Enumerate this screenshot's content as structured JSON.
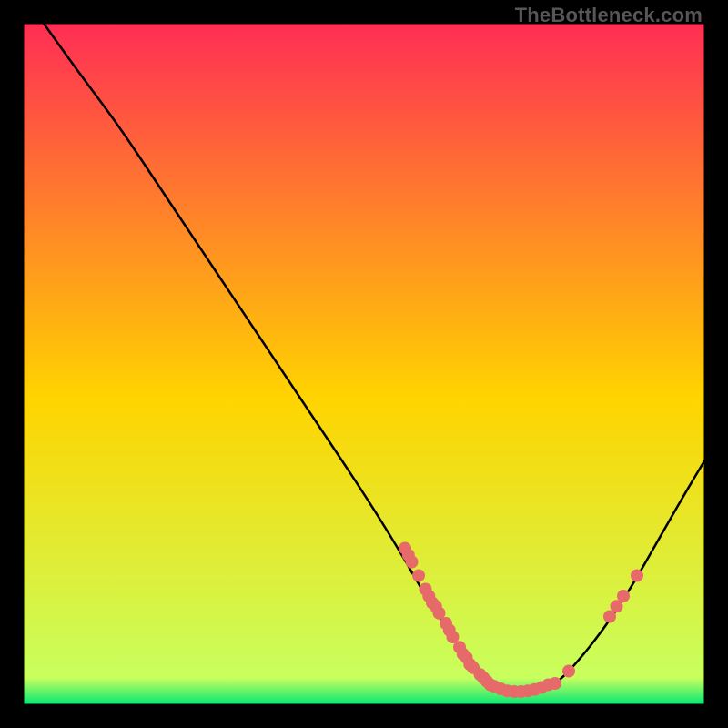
{
  "watermark": "TheBottleneck.com",
  "colors": {
    "gradient_top": "#ff2d55",
    "gradient_mid": "#ffd400",
    "gradient_bottom": "#00e676",
    "curve": "#000000",
    "dot": "#e66a6a",
    "frame": "#000000"
  },
  "chart_data": {
    "type": "line",
    "title": "",
    "xlabel": "",
    "ylabel": "",
    "xlim": [
      0,
      100
    ],
    "ylim": [
      0,
      100
    ],
    "grid": false,
    "legend": false,
    "curve": [
      {
        "x": 3,
        "y": 100
      },
      {
        "x": 8,
        "y": 93
      },
      {
        "x": 14,
        "y": 85
      },
      {
        "x": 20,
        "y": 76
      },
      {
        "x": 26,
        "y": 67
      },
      {
        "x": 32,
        "y": 58
      },
      {
        "x": 38,
        "y": 49
      },
      {
        "x": 44,
        "y": 40
      },
      {
        "x": 50,
        "y": 31
      },
      {
        "x": 55,
        "y": 23
      },
      {
        "x": 59,
        "y": 16
      },
      {
        "x": 63,
        "y": 10
      },
      {
        "x": 66,
        "y": 6
      },
      {
        "x": 69,
        "y": 3
      },
      {
        "x": 72,
        "y": 2
      },
      {
        "x": 75,
        "y": 2
      },
      {
        "x": 78,
        "y": 3
      },
      {
        "x": 81,
        "y": 6
      },
      {
        "x": 85,
        "y": 11
      },
      {
        "x": 89,
        "y": 17
      },
      {
        "x": 93,
        "y": 24
      },
      {
        "x": 97,
        "y": 31
      },
      {
        "x": 100,
        "y": 36
      }
    ],
    "dots": [
      {
        "x": 56,
        "y": 23
      },
      {
        "x": 56.5,
        "y": 22
      },
      {
        "x": 57,
        "y": 21
      },
      {
        "x": 58,
        "y": 19
      },
      {
        "x": 59,
        "y": 17
      },
      {
        "x": 59.5,
        "y": 16
      },
      {
        "x": 60,
        "y": 15
      },
      {
        "x": 60.5,
        "y": 14.5
      },
      {
        "x": 61,
        "y": 13.5
      },
      {
        "x": 62,
        "y": 12
      },
      {
        "x": 62.5,
        "y": 11
      },
      {
        "x": 63,
        "y": 10
      },
      {
        "x": 64,
        "y": 8.5
      },
      {
        "x": 64.5,
        "y": 7.5
      },
      {
        "x": 65,
        "y": 7
      },
      {
        "x": 65.5,
        "y": 6
      },
      {
        "x": 66,
        "y": 5.5
      },
      {
        "x": 67,
        "y": 4.5
      },
      {
        "x": 67.5,
        "y": 4
      },
      {
        "x": 68,
        "y": 3.5
      },
      {
        "x": 68.5,
        "y": 3
      },
      {
        "x": 69,
        "y": 2.8
      },
      {
        "x": 70,
        "y": 2.4
      },
      {
        "x": 71,
        "y": 2.1
      },
      {
        "x": 72,
        "y": 2
      },
      {
        "x": 73,
        "y": 2
      },
      {
        "x": 74,
        "y": 2.1
      },
      {
        "x": 75,
        "y": 2.3
      },
      {
        "x": 76,
        "y": 2.6
      },
      {
        "x": 77,
        "y": 3
      },
      {
        "x": 78,
        "y": 3.2
      },
      {
        "x": 80,
        "y": 5
      },
      {
        "x": 86,
        "y": 13
      },
      {
        "x": 87,
        "y": 14.5
      },
      {
        "x": 88,
        "y": 16
      },
      {
        "x": 90,
        "y": 19
      }
    ]
  }
}
